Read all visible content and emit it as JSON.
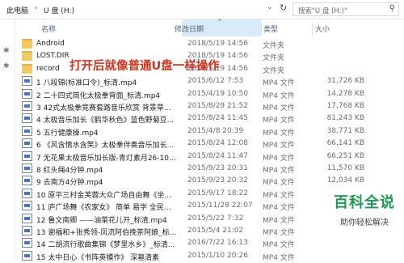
{
  "address": {
    "crumbs": [
      "此电脑",
      "U 盘 (H:)"
    ],
    "search_placeholder": "搜索\"U 盘 (H:)\""
  },
  "columns": {
    "name": "名称",
    "date": "修改日期",
    "type": "类型",
    "size": "大小"
  },
  "rows": [
    {
      "name": "Android",
      "date": "2018/5/19 14:56",
      "type": "文件夹",
      "size": "",
      "kind": "folder"
    },
    {
      "name": "LOST.DIR",
      "date": "2018/5/19 14:56",
      "type": "文件夹",
      "size": "",
      "kind": "folder"
    },
    {
      "name": "record",
      "date": "2018/5/19 14:56",
      "type": "文件夹",
      "size": "",
      "kind": "folder"
    },
    {
      "name": "1 八段锦(标准口令)_标清.mp4",
      "date": "2015/6/12 7:53",
      "type": "MP4 文件",
      "size": "31,726 KB",
      "kind": "file"
    },
    {
      "name": "2 二十四式简化太极拳背面_标清.mp4",
      "date": "2015/4/19 10:50",
      "type": "MP4 文件",
      "size": "14,278 KB",
      "kind": "file"
    },
    {
      "name": "3 42式太极拳竞赛套路音乐欣赏 背景草...",
      "date": "2015/8/29 21:52",
      "type": "MP4 文件",
      "size": "17,768 KB",
      "kind": "file"
    },
    {
      "name": "4 太极音乐加长《鹤华秋色》蓝色野菊豆...",
      "date": "2015/8/24 11:45",
      "type": "MP4 文件",
      "size": "81,243 KB",
      "kind": "file"
    },
    {
      "name": "5 五行健康操.mp4",
      "date": "2015/4/8 20:39",
      "type": "MP4 文件",
      "size": "38,771 KB",
      "kind": "file"
    },
    {
      "name": "6 《风含情水含笑》太极拳伴奏音乐加长...",
      "date": "2015/8/24 12:08",
      "type": "MP4 文件",
      "size": "66,141 KB",
      "kind": "file"
    },
    {
      "name": "7 无花果太极音乐加长版-青灯素月26-10...",
      "date": "2015/8/24 11:47",
      "type": "MP4 文件",
      "size": "66,251 KB",
      "kind": "file"
    },
    {
      "name": "8 红头绳4分钟.mp4",
      "date": "2015/9/23 20:31",
      "type": "MP4 文件",
      "size": "11,570 KB",
      "kind": "file"
    },
    {
      "name": "9 去南方4分钟.mp4",
      "date": "2015/9/23 20:32",
      "type": "MP4 文件",
      "size": "12,034 KB",
      "kind": "file"
    },
    {
      "name": "10 原平三村金芙蓉大众广场自由舞《坐...",
      "date": "2015/9/17 18:22",
      "type": "MP4 文件",
      "size": "",
      "kind": "file"
    },
    {
      "name": "11 庐广场舞《农家女》 简单 易学 全民...",
      "date": "2015/11/28 22:07",
      "type": "MP4 文件",
      "size": "",
      "kind": "file"
    },
    {
      "name": "12 鲁文南卿 ——油菜花儿开_标清.mp4",
      "date": "2015/5/22 7:32",
      "type": "MP4 文件",
      "size": "",
      "kind": "file"
    },
    {
      "name": "13 谢福和+张秀领-凤流阿伯挽茶阿娘_标...",
      "date": "2015/5/4 21:02",
      "type": "MP4 文件",
      "size": "",
      "kind": "file"
    },
    {
      "name": "14 二胡流行歌曲集锦《梦里水乡》_标清...",
      "date": "2016/7/22 16:13",
      "type": "MP4 文件",
      "size": "",
      "kind": "file"
    },
    {
      "name": "15 太中日心《书阵英模作》 深墓清素",
      "date": "2015/1/10 20:26",
      "type": "MP4 文件",
      "size": "",
      "kind": "file"
    }
  ],
  "overlay": {
    "caption": "打开后就像普通U盘一样操作",
    "watermark_title": "百科全说",
    "watermark_sub": "助你轻松解决"
  }
}
